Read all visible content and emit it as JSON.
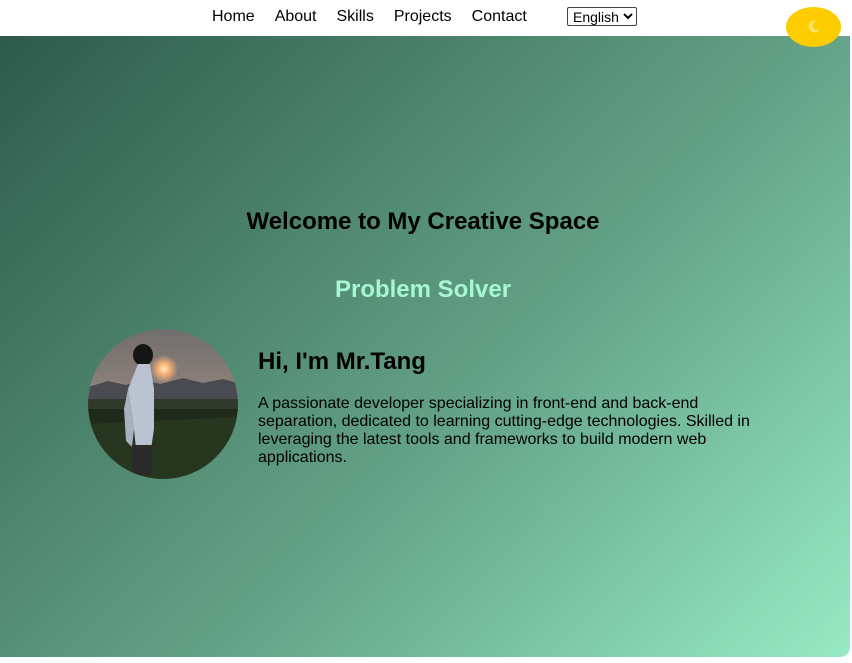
{
  "nav": {
    "links": [
      "Home",
      "About",
      "Skills",
      "Projects",
      "Contact"
    ],
    "language": {
      "selected": "English",
      "options": [
        "English"
      ]
    }
  },
  "theme_toggle": {
    "icon": "moon-icon",
    "color": "#fccb00"
  },
  "hero": {
    "title": "Welcome to My Creative Space",
    "subtitle": "Problem Solver",
    "subtitle_color": "#a6f7d3",
    "gradient": [
      "#2e5a4c",
      "#96ebc4"
    ]
  },
  "about": {
    "greeting": "Hi, I'm Mr.Tang",
    "bio": "A passionate developer specializing in front-end and back-end separation, dedicated to learning cutting-edge technologies. Skilled in leveraging the latest tools and frameworks to build modern web applications."
  }
}
